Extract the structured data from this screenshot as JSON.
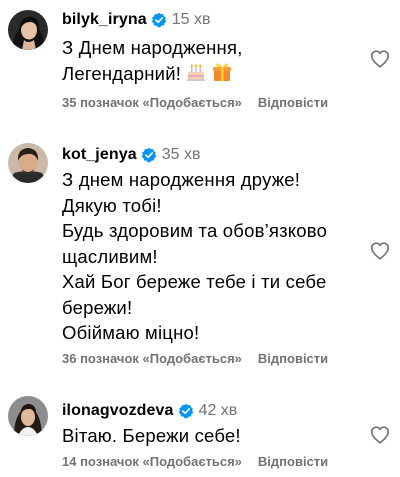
{
  "colors": {
    "text": "#000000",
    "muted": "#737373",
    "verified": "#0095f6"
  },
  "comments": [
    {
      "username": "bilyk_iryna",
      "time": "15 хв",
      "lines": [
        "З Днем народження,",
        "Легендарний!"
      ],
      "emojis": [
        "birthday-cake-icon",
        "gift-icon"
      ],
      "likes": "35 позначок «Подобається»",
      "reply": "Відповісти"
    },
    {
      "username": "kot_jenya",
      "time": "35 хв",
      "lines": [
        "З днем народження друже!",
        "Дякую тобі!",
        "Будь здоровим та обов’язково",
        "щасливим!",
        "Хай Бог береже тебе і ти себе",
        "бережи!",
        "Обіймаю міцно!"
      ],
      "likes": "36 позначок «Подобається»",
      "reply": "Відповісти"
    },
    {
      "username": "ilonagvozdeva",
      "time": "42 хв",
      "lines": [
        "Вітаю. Бережи себе!"
      ],
      "likes": "14 позначок «Подобається»",
      "reply": "Відповісти"
    }
  ]
}
